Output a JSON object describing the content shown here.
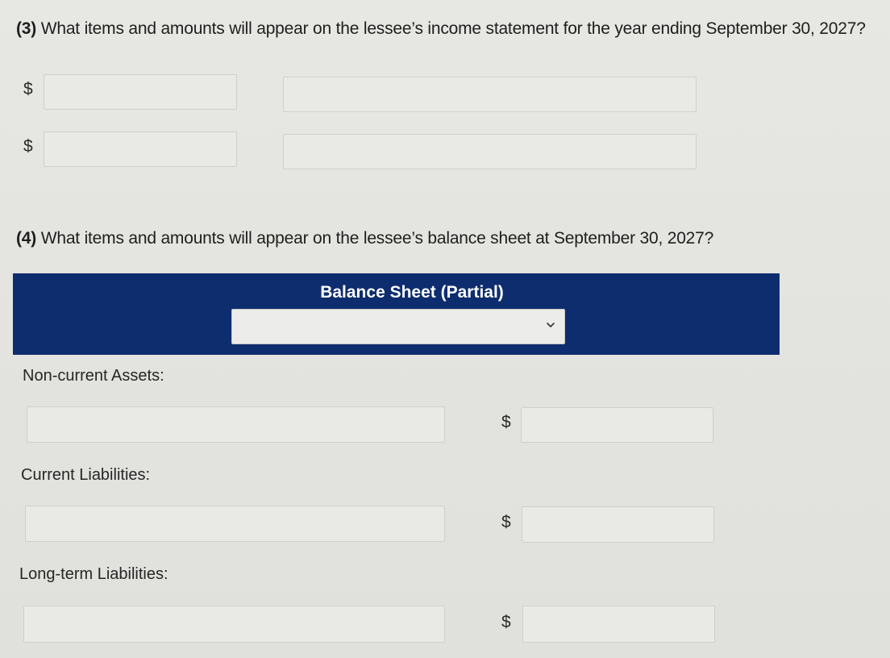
{
  "question3": {
    "number": "(3)",
    "text": "What items and amounts will appear on the lessee’s income statement for the year ending September 30, 2027?"
  },
  "question4": {
    "number": "(4)",
    "text": "What items and amounts will appear on the lessee’s balance sheet at September 30, 2027?"
  },
  "currency_symbol": "$",
  "balance_sheet": {
    "title": "Balance Sheet (Partial)",
    "sections": {
      "non_current_assets": "Non-current Assets:",
      "current_liabilities": "Current Liabilities:",
      "long_term_liabilities": "Long-term Liabilities:"
    }
  },
  "icons": {
    "dropdown": "chevron-down-icon"
  }
}
